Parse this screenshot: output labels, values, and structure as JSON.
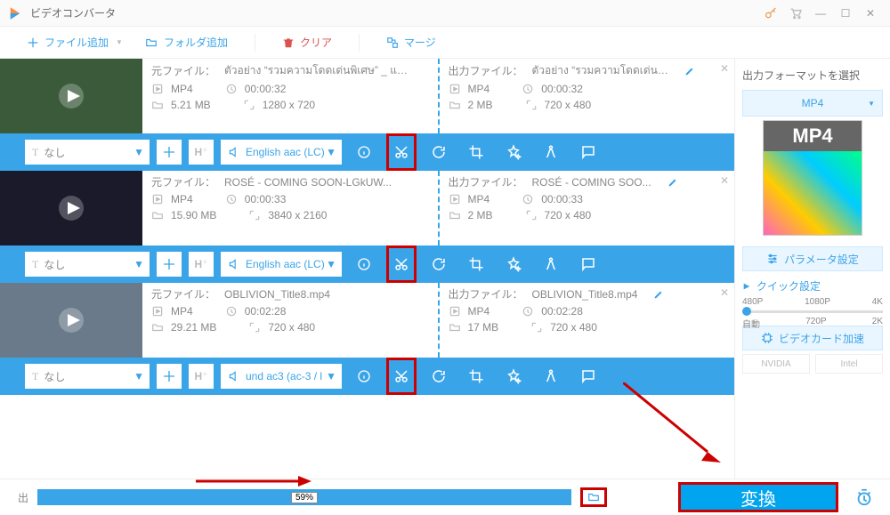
{
  "app": {
    "title": "ビデオコンバータ"
  },
  "toolbar": {
    "add_file": "ファイル追加",
    "add_folder": "フォルダ追加",
    "clear": "クリア",
    "merge": "マージ"
  },
  "sidebar": {
    "format_header": "出力フォーマットを選択",
    "selected_format": "MP4",
    "format_badge": "MP4",
    "param_btn": "パラメータ設定",
    "quick_header": "クイック設定",
    "scale_top": [
      "480P",
      "1080P",
      "4K"
    ],
    "scale_bottom": [
      "自動",
      "720P",
      "2K"
    ],
    "hw_btn": "ビデオカード加速",
    "hw_vendors": [
      "NVIDIA",
      "Intel"
    ]
  },
  "files": [
    {
      "thumb": "thumb-1",
      "source": {
        "label": "元ファイル：",
        "name": "ตัวอย่าง “รวมความโดดเด่นพิเศษ” _ แ…",
        "format": "MP4",
        "duration": "00:00:32",
        "size": "5.21 MB",
        "resolution": "1280 x 720"
      },
      "output": {
        "label": "出力ファイル：",
        "name": "ตัวอย่าง “รวมความโดดเด่น…",
        "format": "MP4",
        "duration": "00:00:32",
        "size": "2 MB",
        "resolution": "720 x 480"
      },
      "subtitle": "なし",
      "audio": "English aac (LC)"
    },
    {
      "thumb": "thumb-2",
      "source": {
        "label": "元ファイル：",
        "name": "ROSÉ - COMING SOON-LGkUW...",
        "format": "MP4",
        "duration": "00:00:33",
        "size": "15.90 MB",
        "resolution": "3840 x 2160"
      },
      "output": {
        "label": "出力ファイル：",
        "name": "ROSÉ - COMING SOO...",
        "format": "MP4",
        "duration": "00:00:33",
        "size": "2 MB",
        "resolution": "720 x 480"
      },
      "subtitle": "なし",
      "audio": "English aac (LC)"
    },
    {
      "thumb": "thumb-3",
      "source": {
        "label": "元ファイル：",
        "name": "OBLIVION_Title8.mp4",
        "format": "MP4",
        "duration": "00:02:28",
        "size": "29.21 MB",
        "resolution": "720 x 480"
      },
      "output": {
        "label": "出力ファイル：",
        "name": "OBLIVION_Title8.mp4",
        "format": "MP4",
        "duration": "00:02:28",
        "size": "17 MB",
        "resolution": "720 x 480"
      },
      "subtitle": "なし",
      "audio": "und ac3 (ac-3 / l"
    }
  ],
  "bottom": {
    "progress_pct": "59%",
    "convert_label": "変換"
  }
}
